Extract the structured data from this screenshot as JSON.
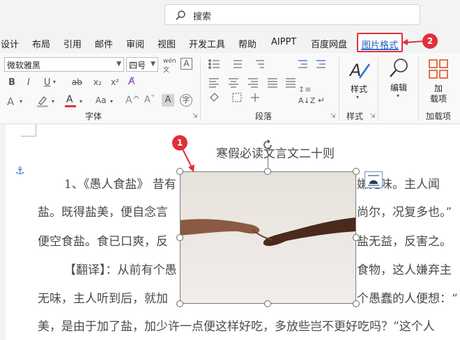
{
  "search": {
    "placeholder": "搜索"
  },
  "tabs": [
    "设计",
    "布局",
    "引用",
    "邮件",
    "审阅",
    "视图",
    "开发工具",
    "帮助",
    "AIPPT",
    "百度网盘"
  ],
  "active_tab": "图片格式",
  "callouts": {
    "one": "1",
    "two": "2"
  },
  "ribbon": {
    "font_name": "微软雅黑",
    "font_size": "四号",
    "group_font": "字体",
    "group_paragraph": "段落",
    "group_style": "样式",
    "group_addins": "加载项",
    "style_btn": "样式",
    "edit_btn": "编辑",
    "addin_btn_line1": "加",
    "addin_btn_line2": "载项"
  },
  "document": {
    "title": "寒假必读文言文二十则",
    "lines": [
      "1、《愚人食盐》 昔有",
      "盐。既得盐美，便自念言",
      "便空食盐。食已口爽，反",
      "【翻译】：从前有个愚",
      "无味，主人听到后，就加",
      "美，是由于加了盐，加少许一点便这样好吃，多放些岂不更好吃吗？”这个人"
    ],
    "right_fragments": [
      "嫌无味。主人闻",
      "尚尔，况复多也。”",
      "盐无益，反害之。",
      "食物，这人嫌弃主",
      "个愚蠢的人便想：“"
    ]
  },
  "colors": {
    "accent_red": "#e0303a",
    "active_tab_text": "#1f5bc4",
    "link_blue": "#2f6fd6"
  }
}
